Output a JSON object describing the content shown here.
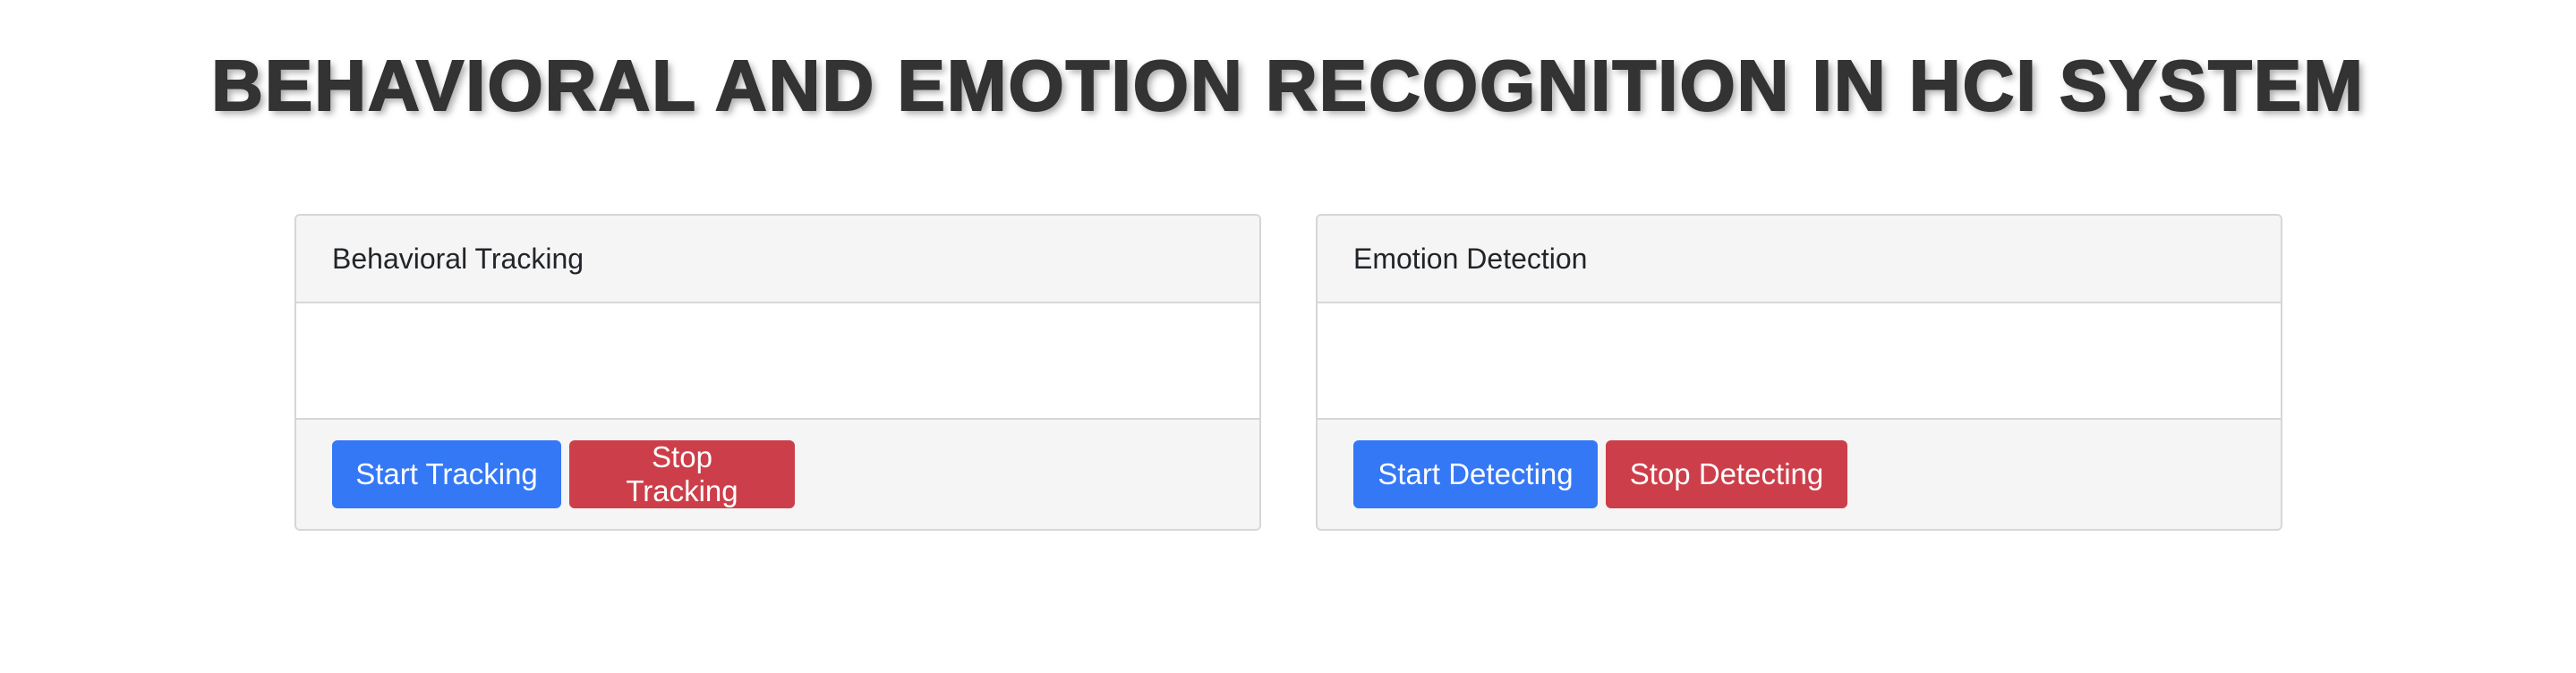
{
  "page": {
    "title": "BEHAVIORAL AND EMOTION RECOGNITION IN HCI SYSTEM"
  },
  "cards": [
    {
      "header": "Behavioral Tracking",
      "start_label": "Start Tracking",
      "stop_label": "Stop Tracking"
    },
    {
      "header": "Emotion Detection",
      "start_label": "Start Detecting",
      "stop_label": "Stop Detecting"
    }
  ],
  "colors": {
    "title": "#333333",
    "primary_button": "#3478f6",
    "danger_button": "#cc3f4a",
    "card_header_bg": "#f5f5f5",
    "card_border": "#d6d6d6"
  }
}
